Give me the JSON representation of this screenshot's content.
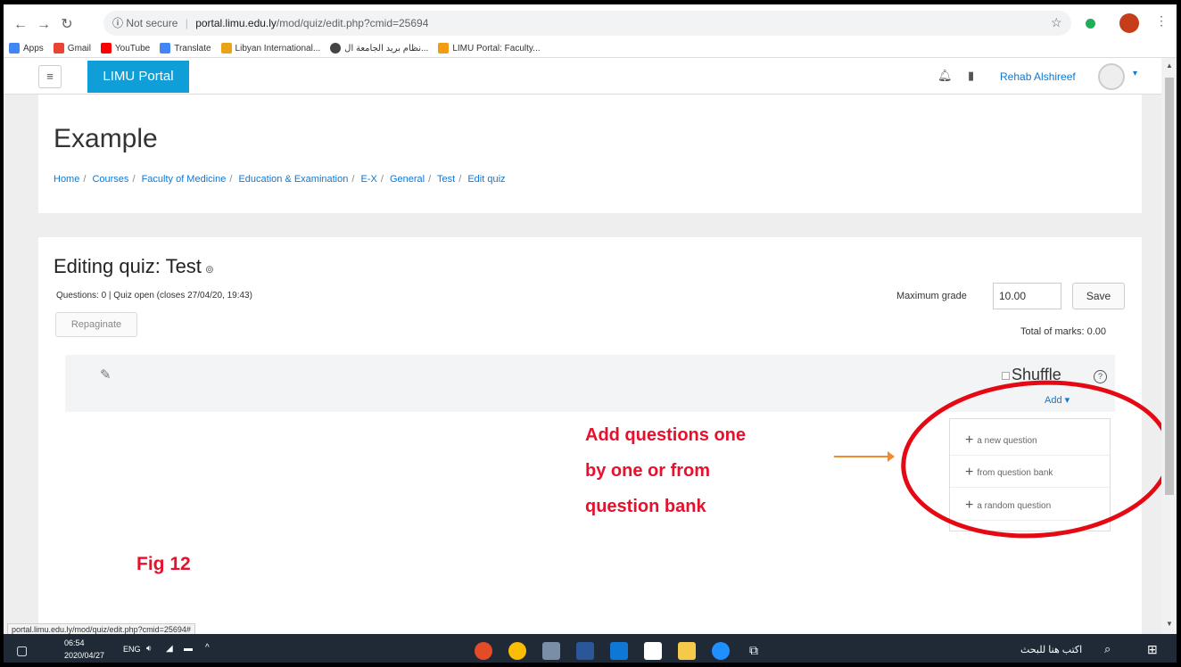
{
  "browser": {
    "security_label": "Not secure",
    "url_host": "portal.limu.edu.ly",
    "url_path": "/mod/quiz/edit.php?cmid=25694",
    "bookmarks": [
      "Apps",
      "Gmail",
      "YouTube",
      "Translate",
      "Libyan International...",
      "نظام بريد الجامعة ال...",
      "LIMU Portal: Faculty..."
    ],
    "status_url": "portal.limu.edu.ly/mod/quiz/edit.php?cmid=25694#"
  },
  "navbar": {
    "brand": "LIMU Portal",
    "user_name": "Rehab Alshireef"
  },
  "header": {
    "title": "Example",
    "breadcrumb": [
      "Home",
      "Courses",
      "Faculty of Medicine",
      "Education & Examination",
      "E-X",
      "General",
      "Test",
      "Edit quiz"
    ]
  },
  "quiz": {
    "title": "Editing quiz: Test",
    "info": "Questions: 0 | Quiz open (closes 27/04/20, 19:43)",
    "repaginate_label": "Repaginate",
    "max_grade_label": "Maximum grade",
    "max_grade_value": "10.00",
    "save_label": "Save",
    "total_marks": "Total of marks: 0.00",
    "shuffle_label": "Shuffle",
    "add_label": "Add",
    "add_menu": [
      "a new question",
      "from question bank",
      "a random question"
    ]
  },
  "annotation": {
    "lines": [
      "Add questions one",
      "by one or from",
      "question bank"
    ],
    "figure_label": "Fig 12",
    "accent_color": "#e8112d"
  },
  "taskbar": {
    "time": "06:54",
    "date": "2020/04/27",
    "lang": "ENG",
    "search_text": "اكتب هنا للبحث"
  }
}
